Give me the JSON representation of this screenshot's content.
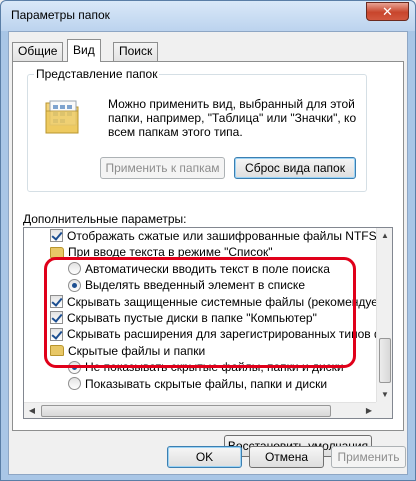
{
  "window": {
    "title": "Параметры папок",
    "close_label": "✕"
  },
  "tabs": [
    {
      "label": "Общие",
      "active": false
    },
    {
      "label": "Вид",
      "active": true
    },
    {
      "label": "Поиск",
      "active": false
    }
  ],
  "folder_views": {
    "legend": "Представление папок",
    "description": "Можно применить вид, выбранный для этой папки, например, \"Таблица\" или \"Значки\", ко всем папкам этого типа.",
    "apply_button": "Применить к папкам",
    "reset_button": "Сброс вида папок"
  },
  "advanced": {
    "label": "Дополнительные параметры:",
    "items": [
      {
        "type": "checkbox",
        "checked": true,
        "indent": 1,
        "label": "Отображать сжатые или зашифрованные файлы NTFS другим цветом"
      },
      {
        "type": "folder",
        "indent": 1,
        "label": "При вводе текста в режиме \"Список\""
      },
      {
        "type": "radio",
        "checked": false,
        "indent": 2,
        "label": "Автоматически вводить текст в поле поиска"
      },
      {
        "type": "radio",
        "checked": true,
        "indent": 2,
        "label": "Выделять введенный элемент в списке"
      },
      {
        "type": "checkbox",
        "checked": true,
        "indent": 1,
        "label": "Скрывать защищенные системные файлы (рекомендуется)"
      },
      {
        "type": "checkbox",
        "checked": true,
        "indent": 1,
        "label": "Скрывать пустые диски в папке \"Компьютер\""
      },
      {
        "type": "checkbox",
        "checked": true,
        "indent": 1,
        "label": "Скрывать расширения для зарегистрированных типов файлов"
      },
      {
        "type": "folder",
        "indent": 1,
        "label": "Скрытые файлы и папки"
      },
      {
        "type": "radio",
        "checked": true,
        "indent": 2,
        "label": "Не показывать скрытые файлы, папки и диски"
      },
      {
        "type": "radio",
        "checked": false,
        "indent": 2,
        "label": "Показывать скрытые файлы, папки и диски"
      }
    ],
    "restore_button": "Восстановить умолчания"
  },
  "footer": {
    "ok": "OK",
    "cancel": "Отмена",
    "apply": "Применить"
  },
  "colors": {
    "highlight": "#e0001a",
    "check": "#1d4f91"
  }
}
